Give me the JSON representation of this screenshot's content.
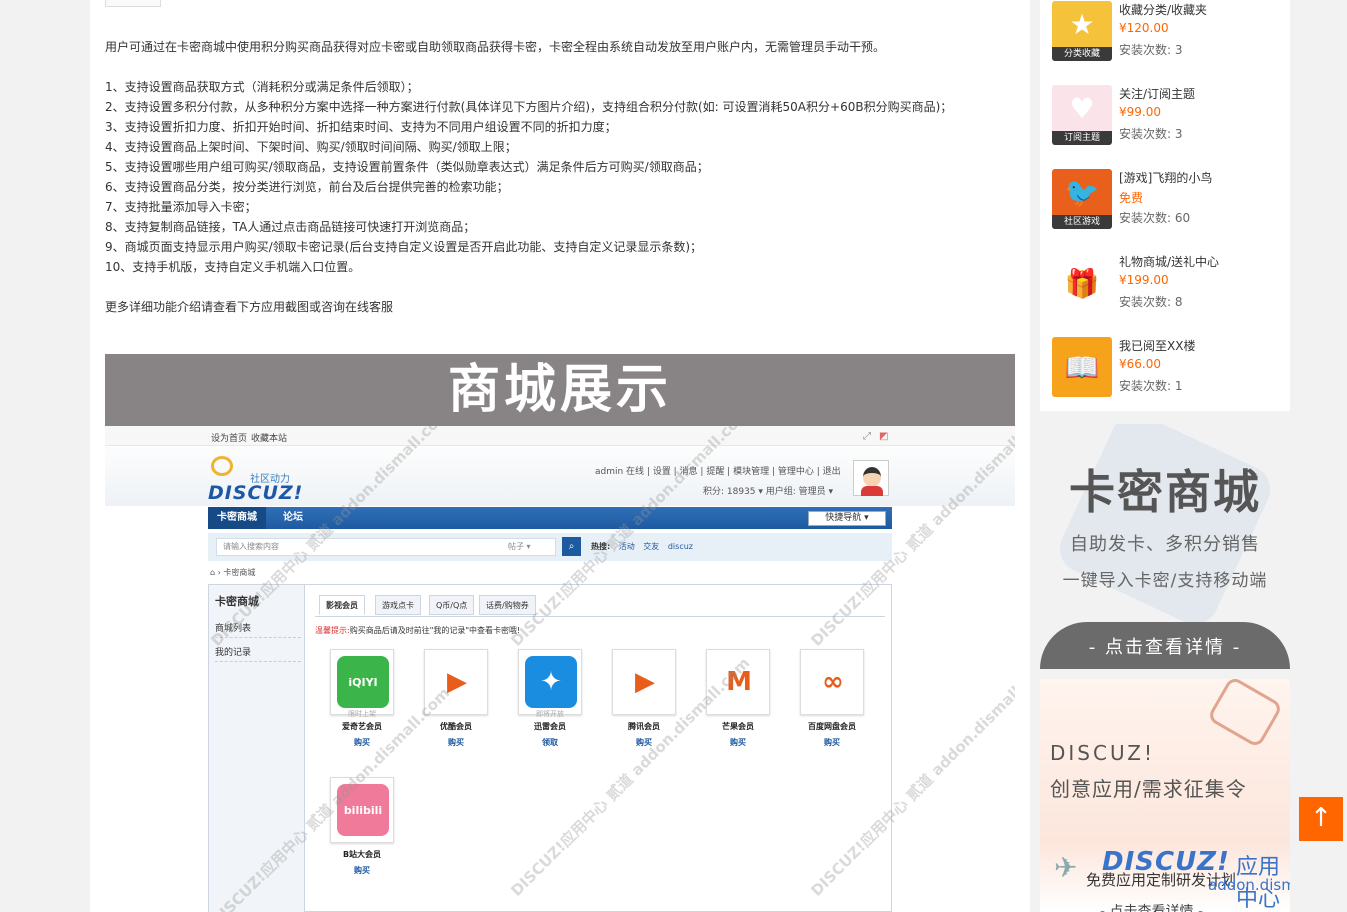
{
  "description": {
    "intro": "用户可通过在卡密商城中使用积分购买商品获得对应卡密或自助领取商品获得卡密，卡密全程由系统自动发放至用户账户内，无需管理员手动干预。",
    "features": [
      "1、支持设置商品获取方式（消耗积分或满足条件后领取）；",
      "2、支持设置多积分付款，从多种积分方案中选择一种方案进行付款(具体详见下方图片介绍)，支持组合积分付款(如: 可设置消耗50A积分+60B积分购买商品)；",
      "3、支持设置折扣力度、折扣开始时间、折扣结束时间、支持为不同用户组设置不同的折扣力度；",
      "4、支持设置商品上架时间、下架时间、购买/领取时间间隔、购买/领取上限；",
      "5、支持设置哪些用户组可购买/领取商品，支持设置前置条件（类似勋章表达式）满足条件后方可购买/领取商品；",
      "6、支持设置商品分类，按分类进行浏览，前台及后台提供完善的检索功能；",
      "7、支持批量添加导入卡密；",
      "8、支持复制商品链接，TA人通过点击商品链接可快速打开浏览商品；",
      "9、商城页面支持显示用户购买/领取卡密记录(后台支持自定义设置是否开启此功能、支持自定义记录显示条数)；",
      "10、支持手机版，支持自定义手机端入口位置。"
    ],
    "more": "更多详细功能介绍请查看下方应用截图或咨询在线客服"
  },
  "banner": {
    "title": "商城展示"
  },
  "screenshot": {
    "top_links": [
      "设为首页",
      "收藏本站"
    ],
    "logo_slogan": "社区动力",
    "logo_word": "DISCUZ!",
    "userbar": "admin 在线 | 设置 | 消息 | 提醒 | 模块管理 | 管理中心 | 退出",
    "userbar2": "积分: 18935 ▾    用户组: 管理员 ▾",
    "nav": {
      "tab1": "卡密商城",
      "tab2": "论坛",
      "quick": "快捷导航 ▾"
    },
    "search": {
      "placeholder": "请输入搜索内容",
      "select": "帖子 ▾",
      "hot_label": "热搜:",
      "hot1": "活动",
      "hot2": "交友",
      "hot3": "discuz"
    },
    "crumb": "⌂ › 卡密商城",
    "side": {
      "title": "卡密商城",
      "item1": "商城列表",
      "item2": "我的记录"
    },
    "tabs": [
      "影视会员",
      "游戏点卡",
      "Q币/Q点",
      "话费/购物券"
    ],
    "tip_label": "温馨提示:",
    "tip": "购买商品后请及时前往\"我的记录\"中查看卡密哦!",
    "products": [
      {
        "name": "爱奇艺会员",
        "note": "限时上架",
        "action": "购买",
        "color": "#3bb54a",
        "glyph": "iQIYI"
      },
      {
        "name": "优酷会员",
        "note": "",
        "action": "购买",
        "color": "#ffffff",
        "glyph": "▶"
      },
      {
        "name": "迅雷会员",
        "note": "即将开放",
        "action": "领取",
        "color": "#1a8de0",
        "glyph": "✦"
      },
      {
        "name": "腾讯会员",
        "note": "",
        "action": "购买",
        "color": "#ffffff",
        "glyph": "▶"
      },
      {
        "name": "芒果会员",
        "note": "",
        "action": "购买",
        "color": "#ffffff",
        "glyph": "M"
      },
      {
        "name": "百度网盘会员",
        "note": "",
        "action": "购买",
        "color": "#ffffff",
        "glyph": "∞"
      },
      {
        "name": "B站大会员",
        "note": "",
        "action": "购买",
        "color": "#f07a9a",
        "glyph": "bilibili"
      }
    ],
    "watermark": "DISCUZ!应用中心 贰道 addon.dismall.com"
  },
  "sidebar_apps": [
    {
      "name": "收藏分类/收藏夹",
      "price": "¥120.00",
      "count": "安装次数: 3",
      "caption": "分类收藏",
      "color": "#f5c23c",
      "glyph": "★"
    },
    {
      "name": "关注/订阅主题",
      "price": "¥99.00",
      "count": "安装次数: 3",
      "caption": "订阅主题",
      "color": "#fbe3ea",
      "glyph": "♥"
    },
    {
      "name": "[游戏]飞翔的小鸟",
      "price": "免费",
      "count": "安装次数: 60",
      "caption": "社区游戏",
      "color": "#e8601c",
      "glyph": "🐦"
    },
    {
      "name": "礼物商城/送礼中心",
      "price": "¥199.00",
      "count": "安装次数: 8",
      "caption": "",
      "color": "#ffffff",
      "glyph": "🎁"
    },
    {
      "name": "我已阅至XX楼",
      "price": "¥66.00",
      "count": "安装次数: 1",
      "caption": "",
      "color": "#f7a21b",
      "glyph": "📖"
    }
  ],
  "ad_kami": {
    "title": "卡密商城",
    "line1": "自助发卡、多积分销售",
    "line2": "一键导入卡密/支持移动端",
    "button": "- 点击查看详情 -"
  },
  "ad_discuz": {
    "line1": "DISCUZ!",
    "line2": "创意应用/需求征集令",
    "logo": "DISCUZ!",
    "app": "应用中心",
    "url": "addon.dismall.com",
    "free": "免费应用定制研发计划",
    "more": "- 点击查看详情 -"
  },
  "back_to_top": "↑"
}
